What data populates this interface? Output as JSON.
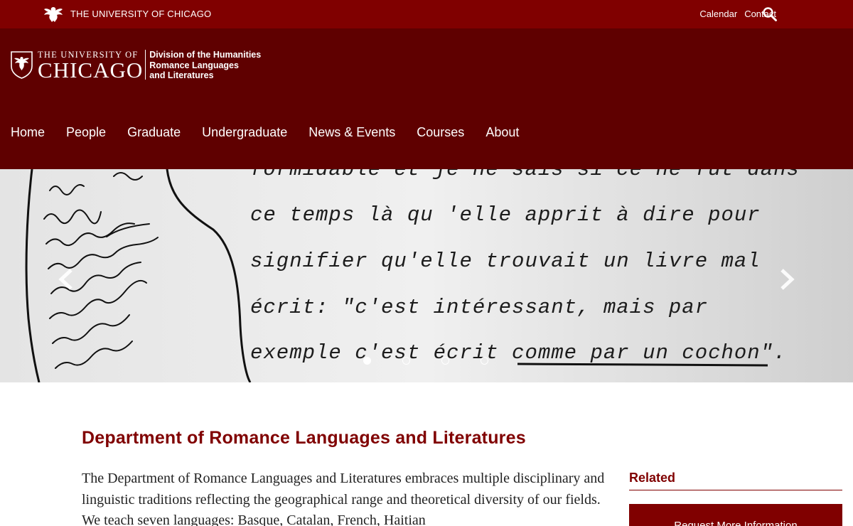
{
  "utility": {
    "university_name": "THE UNIVERSITY OF CHICAGO",
    "links": [
      "Calendar",
      "Contact"
    ],
    "search_icon": "search-icon"
  },
  "brand": {
    "top_line": "THE UNIVERSITY OF",
    "big_line": "CHICAGO",
    "division_lines": [
      "Division of the Humanities",
      "Romance Languages",
      "and Literatures"
    ]
  },
  "nav": {
    "items": [
      "Home",
      "People",
      "Graduate",
      "Undergraduate",
      "News & Events",
      "Courses",
      "About"
    ]
  },
  "hero": {
    "typed_lines": [
      "formidable et je ne sais si ce ne fut dans",
      "ce temps là qu 'elle apprit à dire pour",
      "signifier qu'elle trouvait un livre mal",
      "écrit: \"c'est intéressant, mais par",
      "exemple c'est écrit comme par un cochon\"."
    ],
    "slide_count": 4,
    "active_slide": 1,
    "prev_icon": "chevron-left-icon",
    "next_icon": "chevron-right-icon"
  },
  "content": {
    "title": "Department of Romance Languages and Literatures",
    "intro": "The Department of Romance Languages and Literatures embraces multiple disciplinary and linguistic traditions reflecting the geographical range and theoretical diversity of our fields. We teach seven languages: Basque, Catalan, French, Haitian"
  },
  "sidebar": {
    "related_heading": "Related",
    "button_label": "Request More Information"
  },
  "colors": {
    "maroon": "#800000",
    "dark_maroon": "#5f0000",
    "white": "#ffffff"
  }
}
